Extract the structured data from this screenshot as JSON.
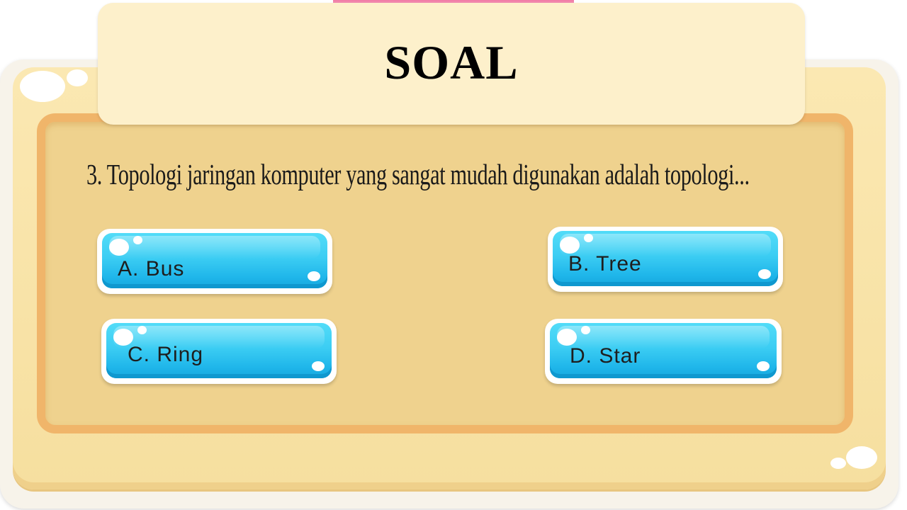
{
  "title": "SOAL",
  "question": "3. Topologi jaringan komputer yang sangat mudah digunakan adalah topologi...",
  "answers": [
    {
      "label": "A. Bus"
    },
    {
      "label": "B. Tree"
    },
    {
      "label": "C. Ring"
    },
    {
      "label": "D. Star"
    }
  ],
  "colors": {
    "board": "#f6df9f",
    "board_border": "#f0b56a",
    "title_card": "#fdf0cb",
    "button": "#3ccdf3"
  }
}
